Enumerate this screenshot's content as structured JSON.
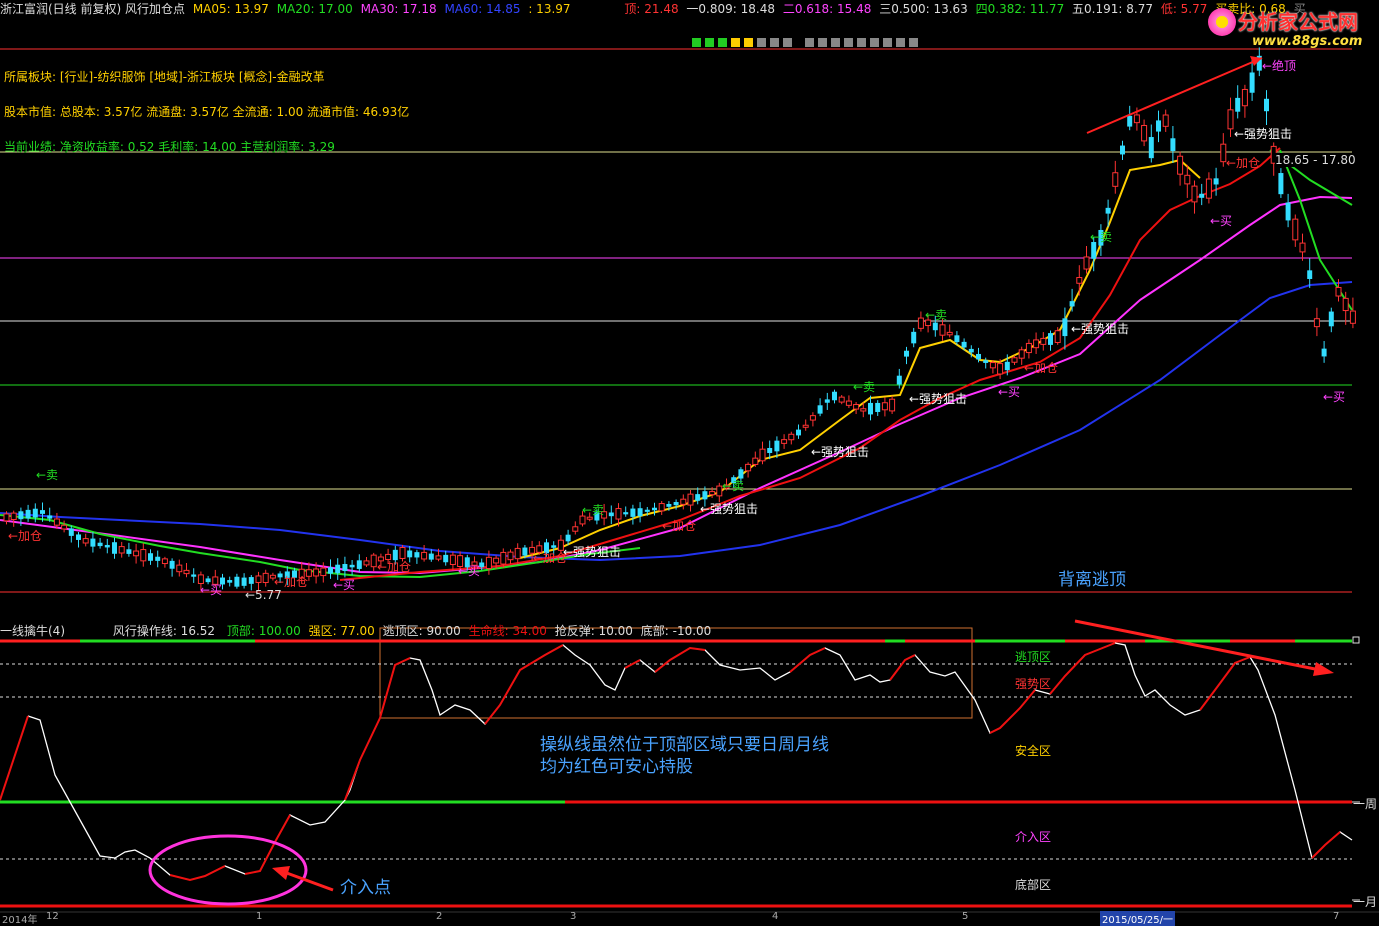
{
  "header": {
    "stock_title": "浙江富润(日线 前复权) 风行加仓点",
    "ma5": "MA05: 13.97",
    "ma20": "MA20: 17.00",
    "ma30": "MA30: 17.18",
    "ma60": "MA60: 14.85",
    "extra": ": 13.97",
    "top": "顶: 21.48",
    "l1": "一0.809: 18.48",
    "l2": "二0.618: 15.48",
    "l3": "三0.500: 13.63",
    "l4": "四0.382: 11.77",
    "l5": "五0.191: 8.77",
    "low": "低: 5.77",
    "buysell": "买卖比: 0.68",
    "tail": "买"
  },
  "logo": {
    "name": "分析家公式网",
    "url": "www.88gs.com"
  },
  "info_lines": {
    "sector": "所属板块: [行业]-纺织服饰 [地域]-浙江板块 [概念]-金融改革",
    "equity": "股本市值: 总股本: 3.57亿 流通盘: 3.57亿 全流通: 1.00 流通市值: 46.93亿",
    "performance": "当前业绩: 净资收益率: 0.52 毛利率: 14.00 主营利润率: 3.29"
  },
  "colors": {
    "ma5": "#ffd000",
    "ma20": "#22dd22",
    "ma30": "#ff44ff",
    "ma60": "#3344ff",
    "up": "#ff3333",
    "down": "#33ddff",
    "accent_line": "#ff2020"
  },
  "price_labels": {
    "sell1": "←卖",
    "add1": "←加仓",
    "buy1": "←买",
    "low_mark": "←5.77",
    "add2": "←加仓",
    "buy2": "←买",
    "add3": "←加仓",
    "buy3": "←买",
    "add4": "←加仓",
    "strike1": "←强势狙击",
    "sell2": "←卖",
    "add5": "←加仓",
    "strike2": "←强势狙击",
    "add6": "←加仓",
    "sell3": "←卖",
    "strike3": "←强势狙击",
    "sell4": "←卖",
    "strike4": "←强势狙击",
    "sell5": "←卖",
    "buy4": "←买",
    "add7": "←加仓",
    "strike5": "←强势狙击",
    "sell6": "←卖",
    "buy5": "←买",
    "add8": "←加仓",
    "strike6": "←强势狙击",
    "jueding": "←绝顶",
    "buy6": "←买",
    "range": "18.65 - 17.80",
    "divergence": "背离逃顶"
  },
  "indicator": {
    "name": "一线擒牛(4)",
    "line": "风行操作线: 16.52",
    "top": "顶部: 100.00",
    "strong": "强区: 77.00",
    "escape": "逃顶区: 90.00",
    "life": "生命线: 34.00",
    "rebound": "抢反弹: 10.00",
    "bottom": "底部: -10.00",
    "zones": {
      "escape_zone": "逃顶区",
      "strong_zone": "强势区",
      "safe_zone": "安全区",
      "entry_zone": "介入区",
      "bottom_zone": "底部区"
    },
    "right_marks": {
      "week": "一周",
      "month": "一月"
    },
    "note_line1": "操纵线虽然位于顶部区域只要日周月线",
    "note_line2": "均为红色可安心持股",
    "entry_point": "介入点"
  },
  "x_axis": {
    "t0": "2014年",
    "t0b": "12",
    "t1": "1",
    "t2": "2",
    "t3": "3",
    "t4": "4",
    "t5": "5",
    "t6": "2015/05/25/一",
    "t7": "7"
  },
  "chart_data": {
    "type": "line",
    "title": "浙江富润(日线 前复权) 风行加仓点",
    "series": [
      {
        "name": "MA05",
        "values": [
          13.97
        ]
      },
      {
        "name": "MA20",
        "values": [
          17.0
        ]
      },
      {
        "name": "MA30",
        "values": [
          17.18
        ]
      },
      {
        "name": "MA60",
        "values": [
          14.85
        ]
      }
    ],
    "fib_levels": [
      21.48,
      18.48,
      15.48,
      13.63,
      11.77,
      8.77,
      5.77
    ],
    "indicator_levels": {
      "top": 100,
      "escape": 90,
      "strong": 77,
      "life": 34,
      "rebound": 10,
      "bottom": -10,
      "operating_line": 16.52
    }
  }
}
